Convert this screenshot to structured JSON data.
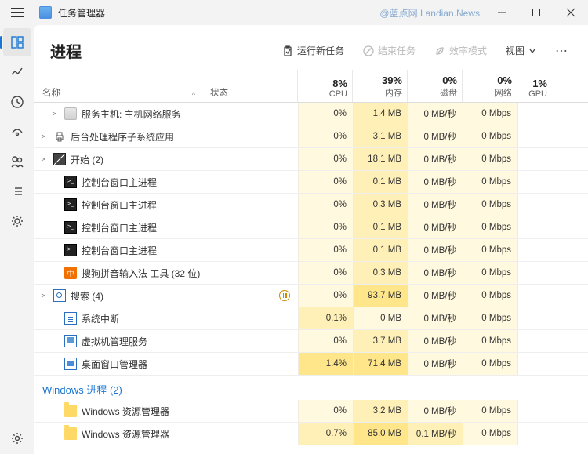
{
  "app": {
    "title": "任务管理器"
  },
  "watermark": "@蓝点网 Landian.News",
  "header": {
    "title": "进程"
  },
  "toolbar": {
    "run": "运行新任务",
    "end": "结束任务",
    "eff": "效率模式",
    "view": "视图"
  },
  "columns": {
    "name": "名称",
    "status": "状态",
    "cpu": {
      "pct": "8%",
      "lbl": "CPU"
    },
    "mem": {
      "pct": "39%",
      "lbl": "内存"
    },
    "disk": {
      "pct": "0%",
      "lbl": "磁盘"
    },
    "net": {
      "pct": "0%",
      "lbl": "网络"
    },
    "gpu": {
      "pct": "1%",
      "lbl": "GPU"
    }
  },
  "rows": [
    {
      "icon": "generic",
      "exp": ">",
      "indent": 1,
      "name": "服务主机: 主机网络服务",
      "cpu": "0%",
      "ch": 0,
      "mem": "1.4 MB",
      "mh": 1,
      "disk": "0 MB/秒",
      "dh": 0,
      "net": "0 Mbps",
      "nh": 0
    },
    {
      "icon": "printer",
      "exp": ">",
      "name": "后台处理程序子系统应用",
      "cpu": "0%",
      "ch": 0,
      "mem": "3.1 MB",
      "mh": 1,
      "disk": "0 MB/秒",
      "dh": 0,
      "net": "0 Mbps",
      "nh": 0
    },
    {
      "icon": "startbox",
      "exp": ">",
      "name": "开始 (2)",
      "cpu": "0%",
      "ch": 0,
      "mem": "18.1 MB",
      "mh": 1,
      "disk": "0 MB/秒",
      "dh": 0,
      "net": "0 Mbps",
      "nh": 0
    },
    {
      "icon": "console",
      "exp": "",
      "indent": 1,
      "name": "控制台窗口主进程",
      "cpu": "0%",
      "ch": 0,
      "mem": "0.1 MB",
      "mh": 1,
      "disk": "0 MB/秒",
      "dh": 0,
      "net": "0 Mbps",
      "nh": 0
    },
    {
      "icon": "console",
      "exp": "",
      "indent": 1,
      "name": "控制台窗口主进程",
      "cpu": "0%",
      "ch": 0,
      "mem": "0.3 MB",
      "mh": 1,
      "disk": "0 MB/秒",
      "dh": 0,
      "net": "0 Mbps",
      "nh": 0
    },
    {
      "icon": "console",
      "exp": "",
      "indent": 1,
      "name": "控制台窗口主进程",
      "cpu": "0%",
      "ch": 0,
      "mem": "0.1 MB",
      "mh": 1,
      "disk": "0 MB/秒",
      "dh": 0,
      "net": "0 Mbps",
      "nh": 0
    },
    {
      "icon": "console",
      "exp": "",
      "indent": 1,
      "name": "控制台窗口主进程",
      "cpu": "0%",
      "ch": 0,
      "mem": "0.1 MB",
      "mh": 1,
      "disk": "0 MB/秒",
      "dh": 0,
      "net": "0 Mbps",
      "nh": 0
    },
    {
      "icon": "orange",
      "exp": "",
      "indent": 1,
      "name": "搜狗拼音输入法 工具 (32 位)",
      "cpu": "0%",
      "ch": 0,
      "mem": "0.3 MB",
      "mh": 1,
      "disk": "0 MB/秒",
      "dh": 0,
      "net": "0 Mbps",
      "nh": 0
    },
    {
      "icon": "search-bl",
      "exp": ">",
      "name": "搜索 (4)",
      "status": "pause",
      "cpu": "0%",
      "ch": 0,
      "mem": "93.7 MB",
      "mh": 2,
      "disk": "0 MB/秒",
      "dh": 0,
      "net": "0 Mbps",
      "nh": 0
    },
    {
      "icon": "sysint",
      "exp": "",
      "indent": 1,
      "name": "系统中断",
      "cpu": "0.1%",
      "ch": 1,
      "mem": "0 MB",
      "mh": 0,
      "disk": "0 MB/秒",
      "dh": 0,
      "net": "0 Mbps",
      "nh": 0
    },
    {
      "icon": "vm",
      "exp": "",
      "indent": 1,
      "name": "虚拟机管理服务",
      "cpu": "0%",
      "ch": 0,
      "mem": "3.7 MB",
      "mh": 1,
      "disk": "0 MB/秒",
      "dh": 0,
      "net": "0 Mbps",
      "nh": 0
    },
    {
      "icon": "dwm",
      "exp": "",
      "indent": 1,
      "name": "桌面窗口管理器",
      "cpu": "1.4%",
      "ch": 2,
      "mem": "71.4 MB",
      "mh": 2,
      "disk": "0 MB/秒",
      "dh": 0,
      "net": "0 Mbps",
      "nh": 0
    }
  ],
  "group2": {
    "title": "Windows 进程 (2)"
  },
  "rows2": [
    {
      "icon": "folder",
      "exp": "",
      "indent": 1,
      "name": "Windows 资源管理器",
      "cpu": "0%",
      "ch": 0,
      "mem": "3.2 MB",
      "mh": 1,
      "disk": "0 MB/秒",
      "dh": 0,
      "net": "0 Mbps",
      "nh": 0
    },
    {
      "icon": "folder",
      "exp": "",
      "indent": 1,
      "name": "Windows 资源管理器",
      "cpu": "0.7%",
      "ch": 1,
      "mem": "85.0 MB",
      "mh": 2,
      "disk": "0.1 MB/秒",
      "dh": 1,
      "net": "0 Mbps",
      "nh": 0
    }
  ]
}
